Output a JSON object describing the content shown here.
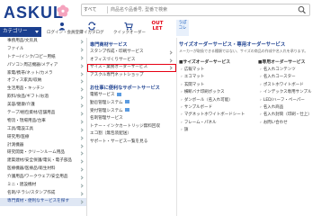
{
  "header": {
    "logo": "ASKUL",
    "search": {
      "scope": "すべて",
      "placeholder": "商品名や品番号, 型番で検索"
    },
    "icons": [
      {
        "icon": "person-icon",
        "label": "ログイン・会員登録"
      },
      {
        "icon": "repeat-order-icon",
        "label": "マイカタログ"
      },
      {
        "icon": "cart-icon",
        "label": "クイックオーダー"
      }
    ],
    "outlet_label": "OUT LET",
    "utsubo_label": "うぽ コレ"
  },
  "category_tab": {
    "label": "カテゴリー"
  },
  "categories": [
    "事務用品/文房具",
    "ファイル",
    "トナー/インク/コピー用紙",
    "パソコン周辺機器/メディア",
    "家電/携帯/ネット/カメラ",
    "オフィス家具/収納",
    "生活用品・キッチン",
    "飲料/食品/ギフト/お酒",
    "美容/健康/介護",
    "テープ/梱包資材/店舗用品",
    "物流・現場用品/台車",
    "工具/電設工具",
    "研究用/医療",
    "計測機器",
    "研究開発・クリーンルーム用品",
    "建築建材/安全保護/電気・電子部品",
    "医療機器/医療品/衛生材料",
    "介護用品/ワークウェア/安全用品",
    "ミニ・建設機材",
    "名刺/チラシ/スタンプ作成",
    "専門資材・便利なサービスを探す"
  ],
  "panel": {
    "specialty_title": "専門商材サービス",
    "specialty_items": [
      {
        "label": "スタンプ作成・印刷サービス",
        "arrow": true,
        "highlight": false
      },
      {
        "label": "オフィスづくりサービス",
        "arrow": true,
        "highlight": false
      },
      {
        "label": "サイズ・業務オーダーサービス",
        "arrow": true,
        "highlight": true
      },
      {
        "label": "アスクル専門ネットショップ",
        "arrow": false,
        "highlight": false
      }
    ],
    "support_title": "お仕事に便利なサポートサービス",
    "support_items": [
      "電帳サービス",
      "勤怠管理システム",
      "受付管理システム",
      "名刺管理サービス",
      "トナー・インクカートリッジ無料回収",
      "エコ割（無包装配送）",
      "サポート・サービス一覧を見る"
    ],
    "order_title": "サイズオーダーサービス・専用オーダーサービス",
    "order_desc": "メーカーが取扱できる種類ではない、サイズの商品の作成や名入れを承ります。",
    "size_head": "■サイズオーダーサービス",
    "size_items": [
      "広報マット",
      "エコマット",
      "玄関マット",
      "横断バナ印刷ボックス",
      "ダンボール（名入れ可能）",
      "サンプルボード",
      "マグネットホワイトボードシート",
      "フレーム・パネル",
      "旗"
    ],
    "custom_head": "■専用オーダーサービス",
    "custom_items": [
      "名入れコンテンツ",
      "名入れコースター",
      "ポストホワイトボード",
      "インデックス専用サンプル",
      "LED/ハーフ・ペーパー",
      "名入れ商品",
      "名入れ封筒（印刷・仕上）",
      "お問い合わせ"
    ]
  }
}
